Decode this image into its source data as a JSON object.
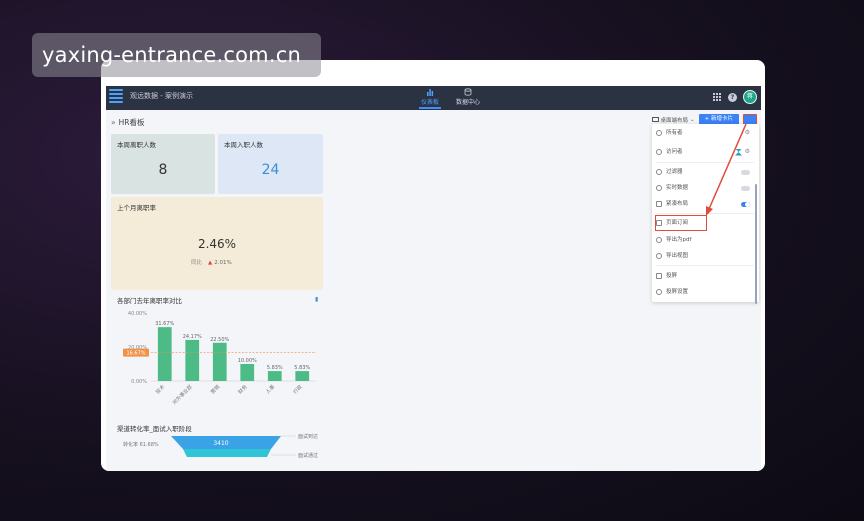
{
  "watermark": "yaxing-entrance.com.cn",
  "app": {
    "name": "观远数据 - 案例演示",
    "tabs": [
      {
        "label": "仪表板",
        "icon": "bar-chart-icon",
        "active": true
      },
      {
        "label": "数据中心",
        "icon": "database-icon",
        "active": false
      }
    ],
    "avatar_text": "蒋"
  },
  "page": {
    "title": "HR看板",
    "layout_label": "桌面端布局",
    "add_card_label": "+ 新增卡片"
  },
  "cards": {
    "weekly_leave": {
      "title": "本周离职人数",
      "value": "8"
    },
    "weekly_join": {
      "title": "本周入职人数",
      "value": "24"
    },
    "last_month_rate": {
      "title": "上个月离职率",
      "value": "2.46%",
      "compare_label": "同比",
      "compare_value": "2.01%"
    }
  },
  "bar_chart": {
    "title": "各部门去年离职率对比"
  },
  "funnel": {
    "title": "渠道转化率_面试入职阶段",
    "value": "3410",
    "left_label": "转化率 61.68%",
    "right_labels": [
      "面试到达",
      "面试通过"
    ]
  },
  "chart_data": {
    "type": "bar",
    "title": "各部门去年离职率对比",
    "categories": [
      "技术",
      "对外事业部",
      "营销",
      "财务",
      "人事",
      "行政"
    ],
    "values": [
      31.67,
      24.17,
      22.5,
      10.0,
      5.83,
      5.83
    ],
    "value_labels": [
      "31.67%",
      "24.17%",
      "22.50%",
      "10.00%",
      "5.83%",
      "5.83%"
    ],
    "yticks": [
      "40.00%",
      "20.00%",
      "0.00%"
    ],
    "ylim": [
      0,
      40
    ],
    "reference_line": {
      "value": 16.67,
      "label": "16.67%"
    },
    "color": "#4dbb86",
    "grid": false
  },
  "menu": {
    "items": [
      {
        "label": "所有者",
        "icon": "user-icon",
        "extra": "gear"
      },
      {
        "label": "访问者",
        "icon": "users-icon",
        "extra": "gear"
      },
      {
        "label": "过滤器",
        "icon": "filter-icon",
        "extra": "toggle-off"
      },
      {
        "label": "实时数据",
        "icon": "clock-icon",
        "extra": "toggle-off"
      },
      {
        "label": "紧凑布局",
        "icon": "layout-icon",
        "extra": "toggle-on"
      },
      {
        "label": "页面订阅",
        "icon": "mail-icon",
        "extra": "",
        "highlight": true
      },
      {
        "label": "导出为pdf",
        "icon": "pdf-icon",
        "extra": ""
      },
      {
        "label": "导出视图",
        "icon": "export-icon",
        "extra": ""
      },
      {
        "label": "投屏",
        "icon": "cast-icon",
        "extra": ""
      },
      {
        "label": "投屏设置",
        "icon": "cast-settings-icon",
        "extra": ""
      }
    ]
  },
  "colors": {
    "accent": "#3b82f6",
    "highlight": "#e34a3a",
    "bar": "#4dbb86",
    "appbar": "#2b3242"
  }
}
